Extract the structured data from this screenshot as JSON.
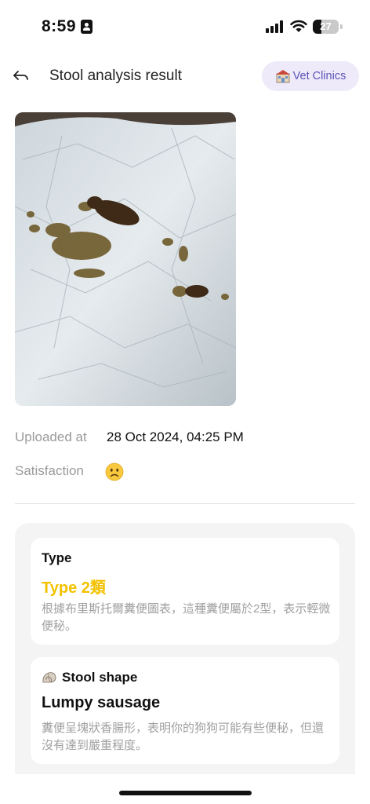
{
  "status_bar": {
    "time": "8:59",
    "battery_level": "27",
    "icons": [
      "contact-card-icon",
      "signal-icon",
      "wifi-icon",
      "battery-icon"
    ]
  },
  "header": {
    "title": "Stool analysis result",
    "back_icon": "back-arrow-icon",
    "vet_button": {
      "icon": "clinic-icon",
      "label": "Vet Clinics"
    }
  },
  "photo": {
    "description_icon": "stool-photo"
  },
  "meta": {
    "uploaded_label": "Uploaded at",
    "uploaded_value": "28 Oct 2024, 04:25 PM",
    "satisfaction_label": "Satisfaction",
    "satisfaction_icon": "slightly-frowning-face-icon"
  },
  "results": {
    "type": {
      "heading": "Type",
      "value": "Type 2類",
      "value_color": "#f2c200",
      "description": "根據布里斯托爾糞便圖表，這種糞便屬於2型，表示輕微便秘。"
    },
    "shape": {
      "icon": "shell-icon",
      "heading": "Stool shape",
      "value": "Lumpy sausage",
      "description": "糞便呈塊狀香腸形，表明你的狗狗可能有些便秘，但還沒有達到嚴重程度。"
    }
  },
  "colors": {
    "accent": "#5b55b8",
    "accent_bg": "#efeaf9",
    "type_yellow": "#f2c200",
    "panel_bg": "#f4f4f5"
  }
}
